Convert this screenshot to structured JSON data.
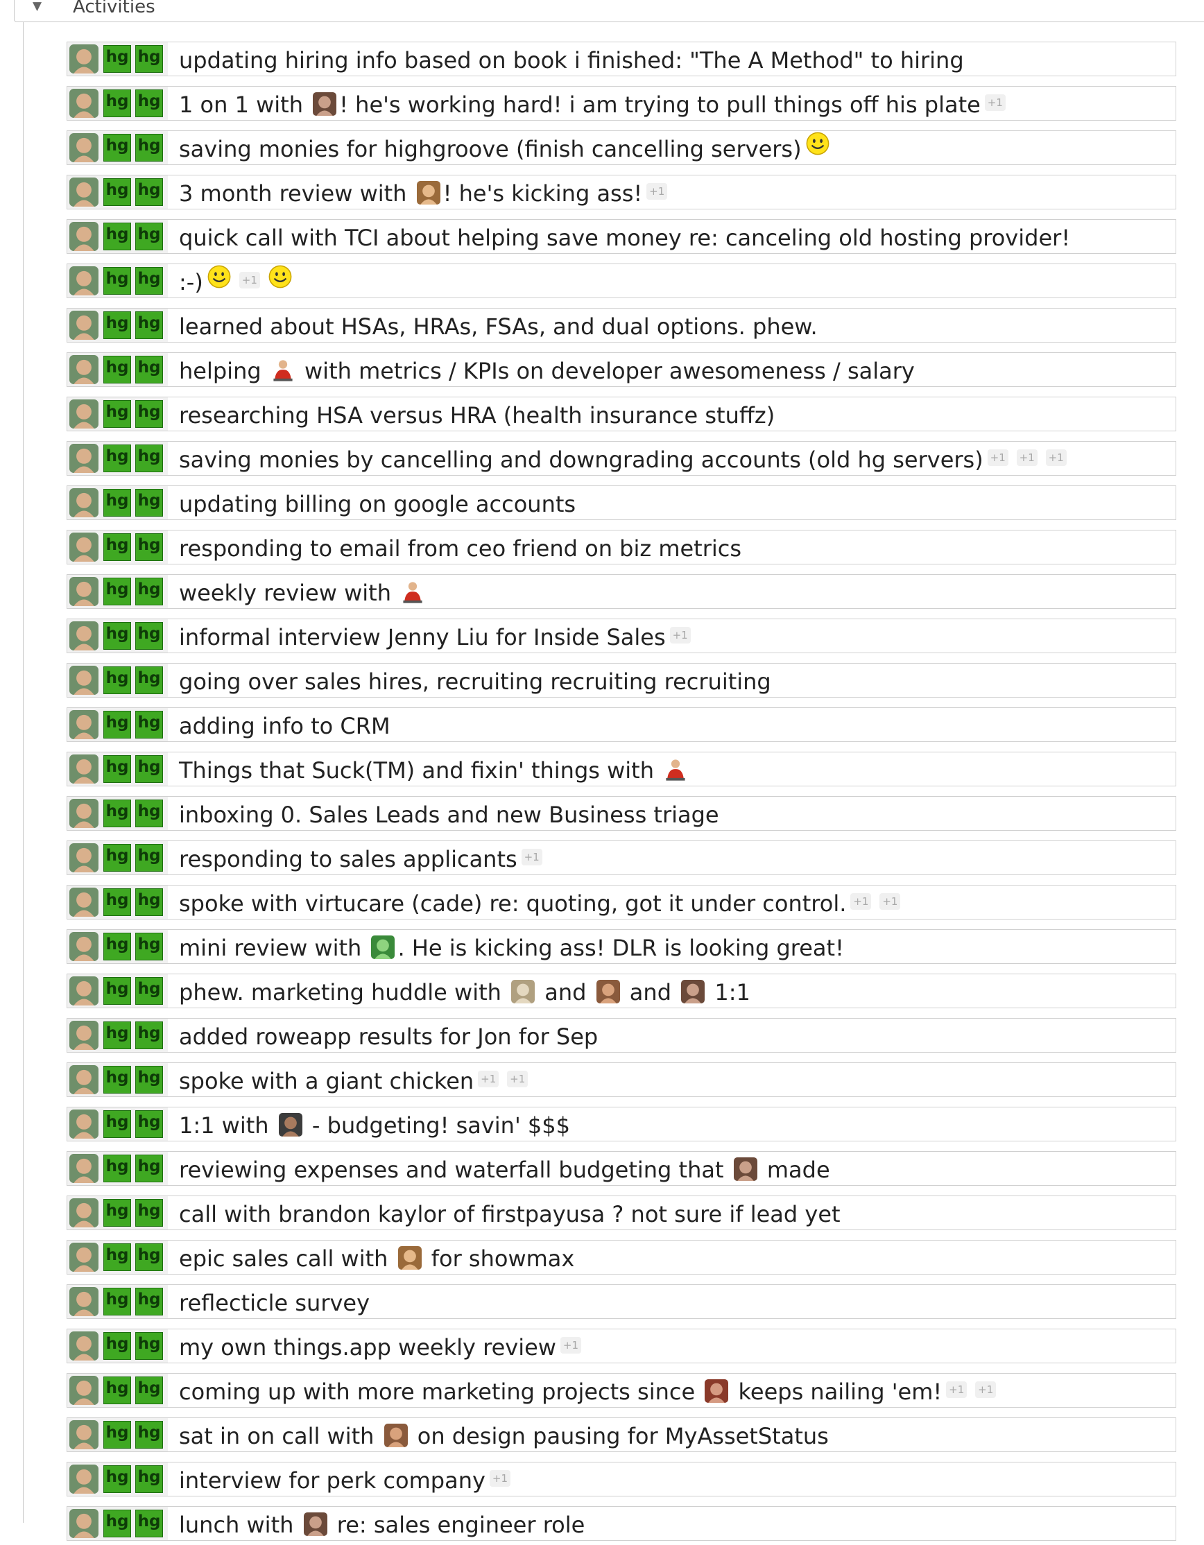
{
  "panel": {
    "title": "Activities"
  },
  "hg_label": "hg",
  "plus_label": "+1",
  "rows": [
    {
      "parts": [
        {
          "t": "updating hiring info based on book i finished: \"The A Method\" to hiring"
        }
      ]
    },
    {
      "parts": [
        {
          "t": "1 on 1 with "
        },
        {
          "a": "avatar-icon"
        },
        {
          "t": "! he's working hard! i am trying to pull things off his plate"
        },
        {
          "p": 1
        }
      ]
    },
    {
      "parts": [
        {
          "t": "saving monies for highgroove (finish cancelling servers)"
        },
        {
          "s": 1
        }
      ]
    },
    {
      "parts": [
        {
          "t": "3 month review with "
        },
        {
          "a": "avatar-icon"
        },
        {
          "t": "! he's kicking ass!"
        },
        {
          "p": 1
        }
      ]
    },
    {
      "parts": [
        {
          "t": "quick call with TCI about helping save money re: canceling old hosting provider!"
        }
      ]
    },
    {
      "parts": [
        {
          "t": ":-)"
        },
        {
          "s": 1
        },
        {
          "p": 1
        },
        {
          "s": 1
        }
      ]
    },
    {
      "parts": [
        {
          "t": "learned about HSAs, HRAs, FSAs, and dual options. phew."
        }
      ]
    },
    {
      "parts": [
        {
          "t": "helping "
        },
        {
          "a": "person-icon"
        },
        {
          "t": " with metrics / KPIs on developer awesomeness / salary"
        }
      ]
    },
    {
      "parts": [
        {
          "t": "researching HSA versus HRA (health insurance stuffz)"
        }
      ]
    },
    {
      "parts": [
        {
          "t": "saving monies by cancelling and downgrading accounts (old hg servers)"
        },
        {
          "p": 1
        },
        {
          "p": 1
        },
        {
          "p": 1
        }
      ]
    },
    {
      "parts": [
        {
          "t": "updating billing on google accounts"
        }
      ]
    },
    {
      "parts": [
        {
          "t": "responding to email from ceo friend on biz metrics"
        }
      ]
    },
    {
      "parts": [
        {
          "t": "weekly review with "
        },
        {
          "a": "person-icon"
        }
      ]
    },
    {
      "parts": [
        {
          "t": "informal interview Jenny Liu for Inside Sales"
        },
        {
          "p": 1
        }
      ]
    },
    {
      "parts": [
        {
          "t": "going over sales hires, recruiting recruiting recruiting"
        }
      ]
    },
    {
      "parts": [
        {
          "t": "adding info to CRM"
        }
      ]
    },
    {
      "parts": [
        {
          "t": "Things that Suck(TM) and fixin' things with "
        },
        {
          "a": "person-icon"
        }
      ]
    },
    {
      "parts": [
        {
          "t": "inboxing 0. Sales Leads and new Business triage"
        }
      ]
    },
    {
      "parts": [
        {
          "t": "responding to sales applicants"
        },
        {
          "p": 1
        }
      ]
    },
    {
      "parts": [
        {
          "t": "spoke with virtucare (cade) re: quoting, got it under control."
        },
        {
          "p": 1
        },
        {
          "p": 1
        }
      ]
    },
    {
      "parts": [
        {
          "t": "mini review with "
        },
        {
          "a": "avatar-icon"
        },
        {
          "t": ". He is kicking ass! DLR is looking great!"
        }
      ]
    },
    {
      "parts": [
        {
          "t": "phew. marketing huddle with "
        },
        {
          "a": "avatar-icon"
        },
        {
          "t": " and "
        },
        {
          "a": "avatar-icon"
        },
        {
          "t": " and "
        },
        {
          "a": "avatar-icon"
        },
        {
          "t": " 1:1"
        }
      ]
    },
    {
      "parts": [
        {
          "t": "added roweapp results for Jon for Sep"
        }
      ]
    },
    {
      "parts": [
        {
          "t": "spoke with a giant chicken"
        },
        {
          "p": 1
        },
        {
          "p": 1
        }
      ]
    },
    {
      "parts": [
        {
          "t": "1:1 with "
        },
        {
          "a": "avatar-icon"
        },
        {
          "t": " - budgeting! savin' $$$"
        }
      ]
    },
    {
      "parts": [
        {
          "t": "reviewing expenses and waterfall budgeting that "
        },
        {
          "a": "avatar-icon"
        },
        {
          "t": " made"
        }
      ]
    },
    {
      "parts": [
        {
          "t": "call with brandon kaylor of firstpayusa ? not sure if lead yet"
        }
      ]
    },
    {
      "parts": [
        {
          "t": "epic sales call with "
        },
        {
          "a": "avatar-icon"
        },
        {
          "t": " for showmax"
        }
      ]
    },
    {
      "parts": [
        {
          "t": "reflecticle survey"
        }
      ]
    },
    {
      "parts": [
        {
          "t": "my own things.app weekly review"
        },
        {
          "p": 1
        }
      ]
    },
    {
      "parts": [
        {
          "t": "coming up with more marketing projects since "
        },
        {
          "a": "avatar-icon"
        },
        {
          "t": " keeps nailing 'em!"
        },
        {
          "p": 1
        },
        {
          "p": 1
        }
      ]
    },
    {
      "parts": [
        {
          "t": "sat in on call with "
        },
        {
          "a": "avatar-icon"
        },
        {
          "t": " on design pausing for MyAssetStatus"
        }
      ]
    },
    {
      "parts": [
        {
          "t": "interview for perk company"
        },
        {
          "p": 1
        }
      ]
    },
    {
      "parts": [
        {
          "t": "lunch with "
        },
        {
          "a": "avatar-icon"
        },
        {
          "t": " re: sales engineer role"
        }
      ]
    }
  ]
}
